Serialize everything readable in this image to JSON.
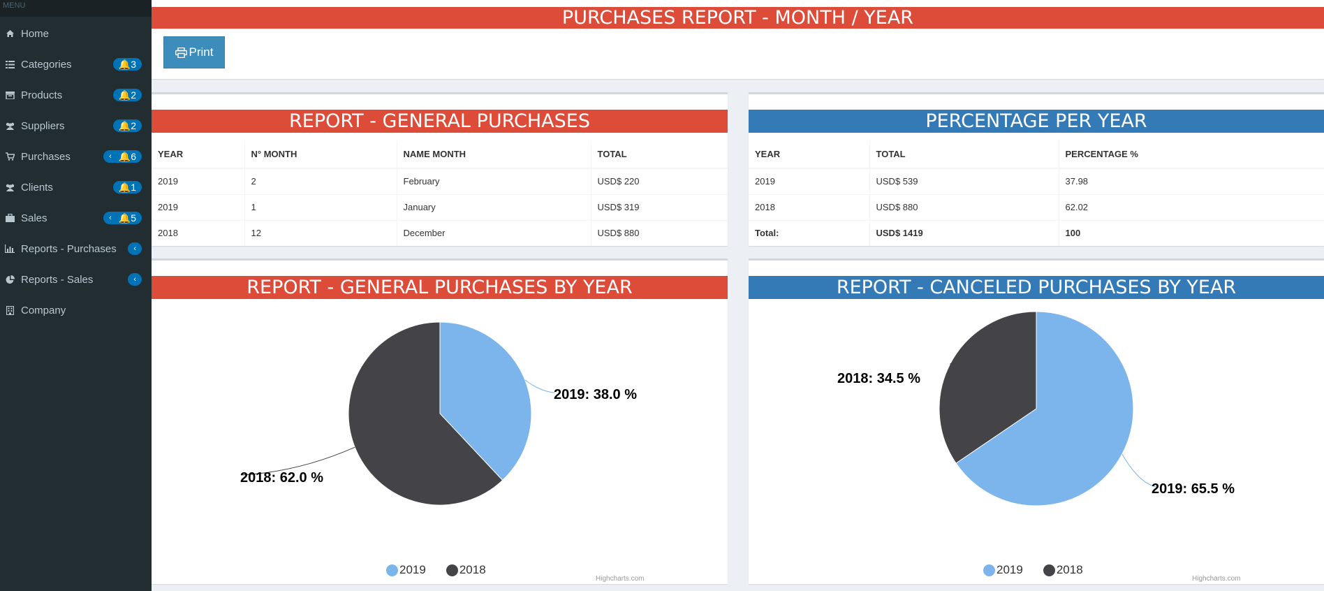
{
  "sidebar": {
    "menu_header": "MENU",
    "items": [
      {
        "label": "Home",
        "icon": "home-icon"
      },
      {
        "label": "Categories",
        "icon": "list-icon",
        "badge": "3"
      },
      {
        "label": "Products",
        "icon": "products-icon",
        "badge": "2"
      },
      {
        "label": "Suppliers",
        "icon": "users-icon",
        "badge": "2"
      },
      {
        "label": "Purchases",
        "icon": "cart-icon",
        "badge": "6"
      },
      {
        "label": "Clients",
        "icon": "users-icon",
        "badge": "1"
      },
      {
        "label": "Sales",
        "icon": "briefcase-icon",
        "badge": "5"
      },
      {
        "label": "Reports - Purchases",
        "icon": "bar-chart-icon"
      },
      {
        "label": "Reports - Sales",
        "icon": "pie-chart-icon"
      },
      {
        "label": "Company",
        "icon": "building-icon"
      }
    ]
  },
  "header": {
    "title": "PURCHASES REPORT - MONTH / YEAR",
    "print_label": "Print"
  },
  "general_table": {
    "title": "REPORT - GENERAL PURCHASES",
    "columns": [
      "YEAR",
      "N° MONTH",
      "NAME MONTH",
      "TOTAL"
    ],
    "rows": [
      [
        "2019",
        "2",
        "February",
        "USD$ 220"
      ],
      [
        "2019",
        "1",
        "January",
        "USD$ 319"
      ],
      [
        "2018",
        "12",
        "December",
        "USD$ 880"
      ]
    ]
  },
  "percentage_table": {
    "title": "PERCENTAGE PER YEAR",
    "columns": [
      "YEAR",
      "TOTAL",
      "PERCENTAGE %"
    ],
    "rows": [
      [
        "2019",
        "USD$ 539",
        "37.98"
      ],
      [
        "2018",
        "USD$ 880",
        "62.02"
      ]
    ],
    "total_row": [
      "Total:",
      "USD$ 1419",
      "100"
    ]
  },
  "colors": {
    "red": "#dd4b39",
    "blue": "#337ab7",
    "slice_2019": "#7cb5ec",
    "slice_2018": "#434348"
  },
  "chart_data": [
    {
      "type": "pie",
      "title": "REPORT - GENERAL PURCHASES BY YEAR",
      "categories": [
        "2019",
        "2018"
      ],
      "values": [
        38.0,
        62.0
      ],
      "labels": [
        "2019: 38.0 %",
        "2018: 62.0 %"
      ],
      "legend": [
        "2019",
        "2018"
      ],
      "legend_position": "bottom",
      "credits": "Highcharts.com"
    },
    {
      "type": "pie",
      "title": "REPORT - CANCELED PURCHASES BY YEAR",
      "categories": [
        "2019",
        "2018"
      ],
      "values": [
        65.5,
        34.5
      ],
      "labels": [
        "2019: 65.5 %",
        "2018: 34.5 %"
      ],
      "legend": [
        "2019",
        "2018"
      ],
      "legend_position": "bottom",
      "credits": "Highcharts.com"
    }
  ]
}
